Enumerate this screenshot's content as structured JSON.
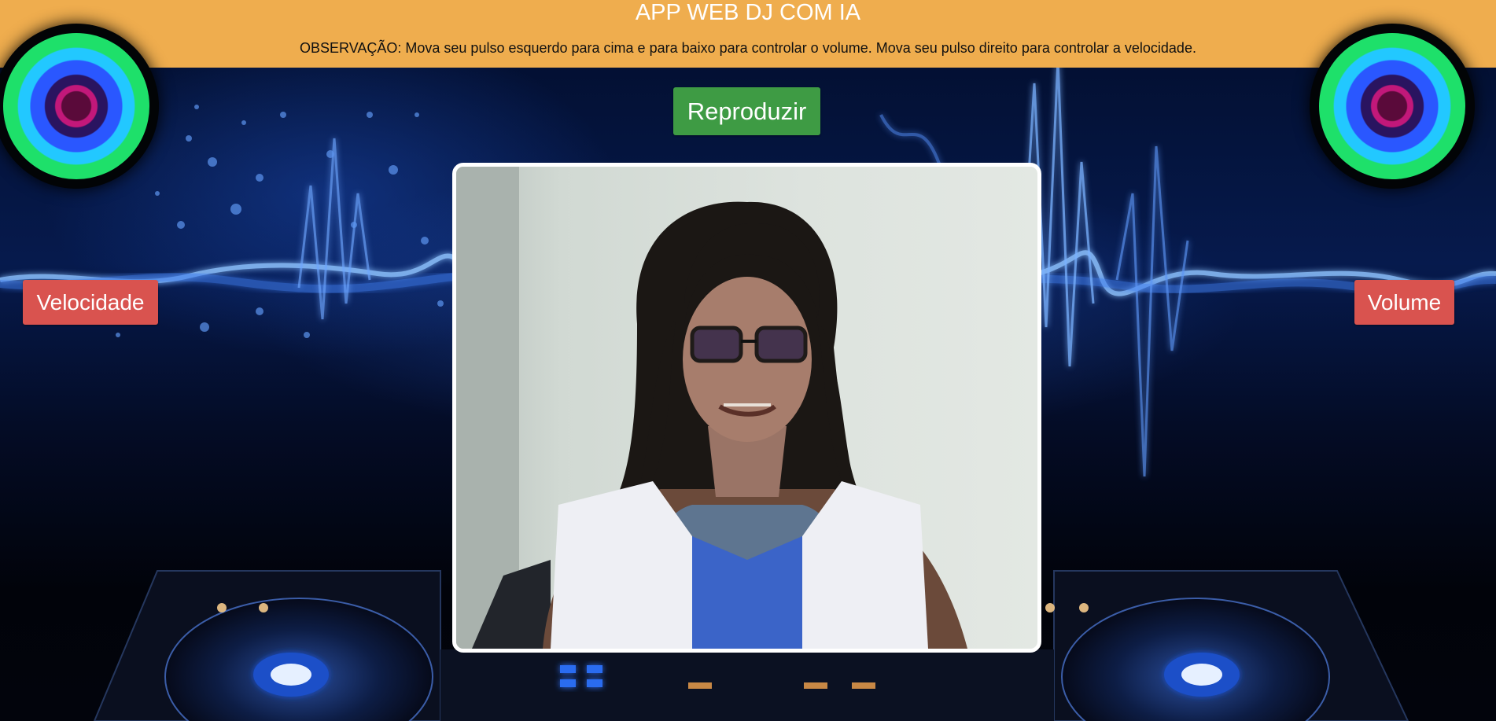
{
  "header": {
    "title": "APP WEB DJ COM IA",
    "note": "OBSERVAÇÃO: Mova seu pulso esquerdo para cima e para baixo para controlar o volume. Mova seu pulso direito para controlar a velocidade."
  },
  "controls": {
    "play_label": "Reproduzir",
    "speed_label": "Velocidade",
    "volume_label": "Volume"
  },
  "colors": {
    "header_bg": "#efad4e",
    "play_button": "#3e9b44",
    "label_buttons": "#d9534f",
    "camera_border": "#ffffff"
  },
  "icons": {
    "speakers": "neon-speaker-icon",
    "turntables": "dj-turntable-icon"
  }
}
